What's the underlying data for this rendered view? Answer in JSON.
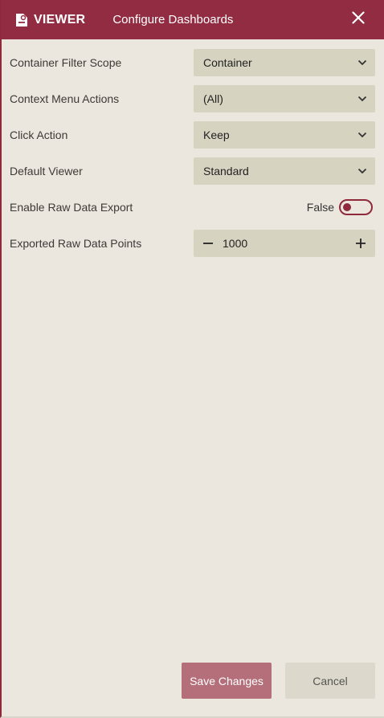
{
  "header": {
    "logo_text": "VIEWER",
    "title": "Configure Dashboards"
  },
  "settings": {
    "container_filter_scope": {
      "label": "Container Filter Scope",
      "value": "Container"
    },
    "context_menu_actions": {
      "label": "Context Menu Actions",
      "value": "(All)"
    },
    "click_action": {
      "label": "Click Action",
      "value": "Keep"
    },
    "default_viewer": {
      "label": "Default Viewer",
      "value": "Standard"
    },
    "enable_raw_data_export": {
      "label": "Enable Raw Data Export",
      "value": "False"
    },
    "exported_raw_data_points": {
      "label": "Exported Raw Data Points",
      "value": "1000"
    }
  },
  "footer": {
    "save_label": "Save Changes",
    "cancel_label": "Cancel"
  },
  "colors": {
    "accent": "#922c42",
    "panel_bg": "#ebe7df",
    "control_bg": "#d7d3c1"
  },
  "icons": [
    "viewer-logo-icon",
    "close-icon",
    "chevron-down-icon",
    "minus-icon",
    "plus-icon"
  ]
}
